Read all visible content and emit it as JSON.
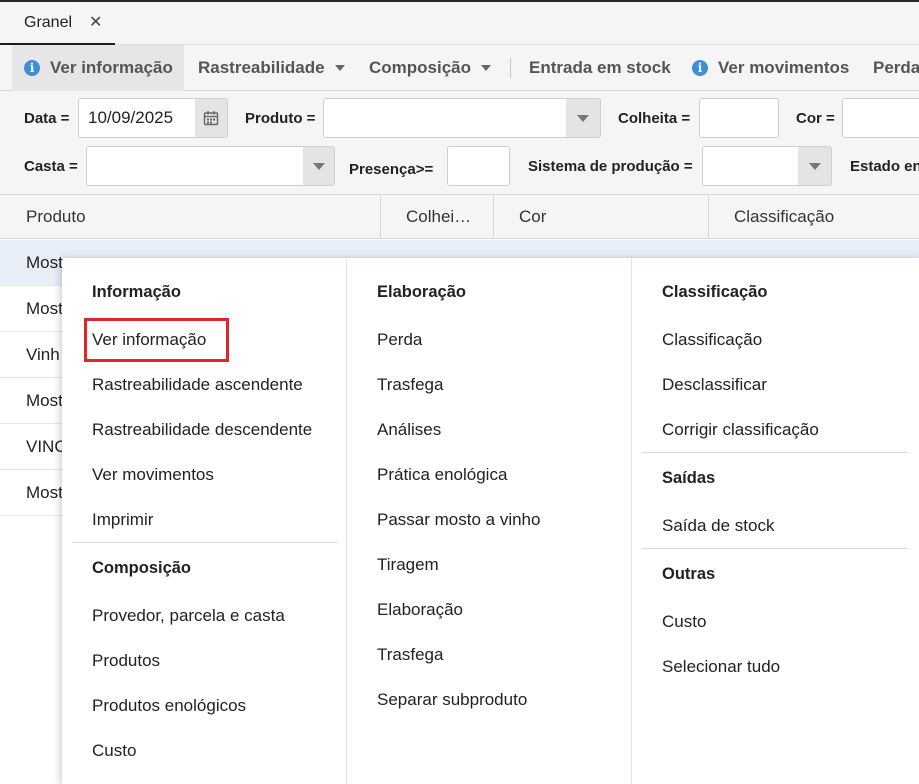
{
  "tab": {
    "title": "Granel",
    "close_glyph": "✕"
  },
  "toolbar": {
    "ver_info": "Ver informação",
    "rastreabilidade": "Rastreabilidade",
    "composicao": "Composição",
    "entrada_stock": "Entrada em stock",
    "ver_movimentos": "Ver movimentos",
    "perda": "Perda",
    "icons": {
      "info": "info-icon",
      "dropdown": "chevron-down-icon"
    }
  },
  "filters": {
    "data_label": "Data =",
    "data_value": "10/09/2025",
    "produto_label": "Produto =",
    "produto_value": "",
    "colheita_label": "Colheita =",
    "colheita_value": "",
    "cor_label": "Cor =",
    "cor_value": "",
    "casta_label": "Casta =",
    "casta_value": "",
    "presenca_label": "Presença>=",
    "presenca_value": "",
    "sistema_label": "Sistema de produção =",
    "sistema_value": "",
    "estado_label": "Estado en"
  },
  "grid": {
    "columns": [
      "Produto",
      "Colhei…",
      "Cor",
      "Classificação"
    ],
    "rows": [
      "Most",
      "Most",
      "Vinh",
      "Most",
      "VINC",
      "Most"
    ]
  },
  "menu": {
    "informacao": {
      "title": "Informação",
      "items": [
        "Ver informação",
        "Rastreabilidade ascendente",
        "Rastreabilidade descendente",
        "Ver movimentos",
        "Imprimir"
      ]
    },
    "composicao": {
      "title": "Composição",
      "items": [
        "Provedor, parcela e casta",
        "Produtos",
        "Produtos enológicos",
        "Custo"
      ]
    },
    "elaboracao": {
      "title": "Elaboração",
      "items": [
        "Perda",
        "Trasfega",
        "Análises",
        "Prática enológica",
        "Passar mosto a vinho",
        "Tiragem",
        "Elaboração",
        "Trasfega",
        "Separar subproduto"
      ]
    },
    "classificacao": {
      "title": "Classificação",
      "items": [
        "Classificação",
        "Desclassificar",
        "Corrigir classificação"
      ]
    },
    "saidas": {
      "title": "Saídas",
      "items": [
        "Saída de stock"
      ]
    },
    "outras": {
      "title": "Outras",
      "items": [
        "Custo",
        "Selecionar tudo"
      ]
    }
  },
  "colors": {
    "highlight": "#e0252b",
    "info_blue": "#3d8fd6",
    "selected_row": "#e7eef8"
  }
}
